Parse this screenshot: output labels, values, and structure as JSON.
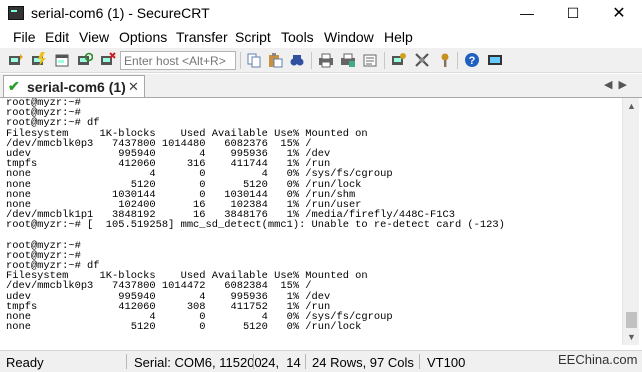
{
  "window": {
    "title": "serial-com6 (1) - SecureCRT",
    "minimize": "—",
    "maximize": "☐",
    "close": "✕"
  },
  "menu": [
    "File",
    "Edit",
    "View",
    "Options",
    "Transfer",
    "Script",
    "Tools",
    "Window",
    "Help"
  ],
  "toolbar": {
    "host_placeholder": "Enter host <Alt+R>"
  },
  "tab": {
    "label": "serial-com6 (1)",
    "close": "✕",
    "arrows": "◀▶"
  },
  "terminal_lines": [
    "root@myzr:~#",
    "root@myzr:~#",
    "root@myzr:~# df",
    "Filesystem     1K-blocks    Used Available Use% Mounted on",
    "/dev/mmcblk0p3   7437800 1014480   6082376  15% /",
    "udev              995940       4    995936   1% /dev",
    "tmpfs             412060     316    411744   1% /run",
    "none                   4       0         4   0% /sys/fs/cgroup",
    "none                5120       0      5120   0% /run/lock",
    "none             1030144       0   1030144   0% /run/shm",
    "none              102400      16    102384   1% /run/user",
    "/dev/mmcblk1p1   3848192      16   3848176   1% /media/firefly/448C-F1C3",
    "root@myzr:~# [  105.519258] mmc_sd_detect(mmc1): Unable to re-detect card (-123)",
    "",
    "root@myzr:~#",
    "root@myzr:~#",
    "root@myzr:~# df",
    "Filesystem     1K-blocks    Used Available Use% Mounted on",
    "/dev/mmcblk0p3   7437800 1014472   6082384  15% /",
    "udev              995940       4    995936   1% /dev",
    "tmpfs             412060     308    411752   1% /run",
    "none                   4       0         4   0% /sys/fs/cgroup",
    "none                5120       0      5120   0% /run/lock"
  ],
  "status": {
    "state": "Ready",
    "serial": "Serial: COM6, 115200",
    "cursor": "24,  14",
    "size": "24 Rows, 97 Cols",
    "emulation": "VT100"
  },
  "watermark": "EEChina.com",
  "icons": [
    "connect-icon",
    "quick-connect-icon",
    "connect-in-tab-icon",
    "reconnect-icon",
    "disconnect-icon",
    "copy-icon",
    "paste-icon",
    "find-icon",
    "print-icon",
    "print-setup-icon",
    "log-icon",
    "session-options-icon",
    "global-options-icon",
    "keymap-icon",
    "help-icon",
    "about-icon"
  ]
}
